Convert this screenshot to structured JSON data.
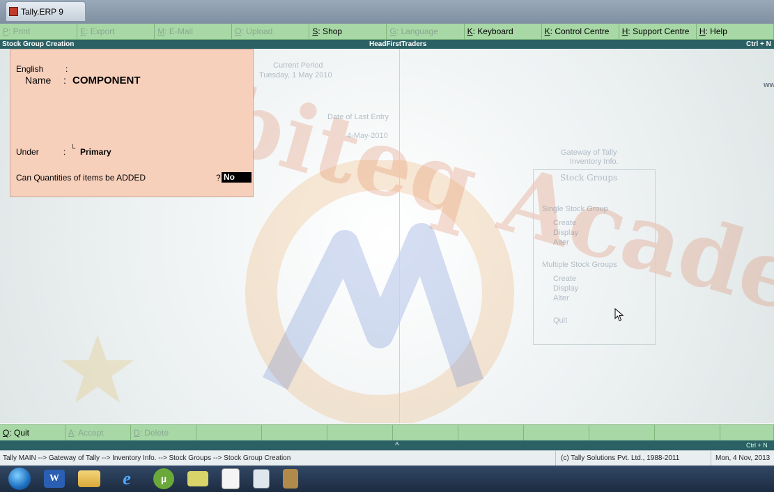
{
  "window": {
    "title": "Tally.ERP 9"
  },
  "top_buttons": [
    {
      "key": "P",
      "label": ": Print",
      "enabled": false
    },
    {
      "key": "E",
      "label": ": Export",
      "enabled": false
    },
    {
      "key": "M",
      "label": ": E-Mail",
      "enabled": false
    },
    {
      "key": "O",
      "label": ": Upload",
      "enabled": false
    },
    {
      "key": "S",
      "label": ": Shop",
      "enabled": true
    },
    {
      "key": "G",
      "label": ": Language",
      "enabled": false
    },
    {
      "key": "K",
      "label": ": Keyboard",
      "enabled": true
    },
    {
      "key": "K",
      "label": ": Control Centre",
      "enabled": true
    },
    {
      "key": "H",
      "label": ": Support Centre",
      "enabled": true
    },
    {
      "key": "H",
      "label": ": Help",
      "enabled": true
    }
  ],
  "header": {
    "screen": "Stock Group Creation",
    "company": "HeadFirstTraders",
    "shortcut": "Ctrl + N"
  },
  "form": {
    "name_label_1": "English",
    "name_label_2": "Name",
    "colon_1": ":",
    "colon_2": ":",
    "name_value": "COMPONENT",
    "under_label": "Under",
    "under_colon": ":",
    "under_marker": "└",
    "under_value": "Primary",
    "qty_label": "Can Quantities of items be ADDED",
    "qty_q": "?",
    "qty_value": "No"
  },
  "background_text": {
    "period_label": "Current Period",
    "period_value": "Tuesday, 1 May 2010",
    "date_label": "Date of Last Entry",
    "date_value": "4-May-2010",
    "gateway_title": "Gateway of Tally",
    "inventory": "Inventory Info.",
    "panel_title": "Stock Groups",
    "single": "Single Stock Group",
    "single_items": [
      "Create",
      "Display",
      "Alter"
    ],
    "multiple": "Multiple Stock Groups",
    "multiple_items": [
      "Create",
      "Display",
      "Alter"
    ],
    "quit": "Quit",
    "right_edge": "ww"
  },
  "watermark": {
    "text": "Mobiteq Academy"
  },
  "bottom_buttons": [
    {
      "key": "Q",
      "label": ": Quit",
      "enabled": true
    },
    {
      "key": "A",
      "label": ": Accept",
      "enabled": false
    },
    {
      "key": "D",
      "label": ": Delete",
      "enabled": false
    }
  ],
  "status_strip": {
    "shortcut": "Ctrl + N",
    "caret": "^"
  },
  "status": {
    "breadcrumb": "Tally MAIN --> Gateway of Tally --> Inventory Info. --> Stock Groups --> Stock Group Creation",
    "copyright": "(c) Tally Solutions Pvt. Ltd., 1988-2011",
    "date": "Mon, 4 Nov, 2013"
  },
  "taskbar": {
    "items": [
      "start-orb-icon",
      "word-icon",
      "file-explorer-icon",
      "internet-explorer-icon",
      "utorrent-icon",
      "sticky-notes-icon",
      "tally-erp-icon",
      "calculator-icon",
      "app-icon"
    ]
  },
  "colors": {
    "button_bar": "#a8d8a6",
    "header_strip": "#2b6164",
    "form_panel": "#f7d0bc",
    "selected_value_bg": "#000000",
    "selected_value_fg": "#ffffff"
  }
}
